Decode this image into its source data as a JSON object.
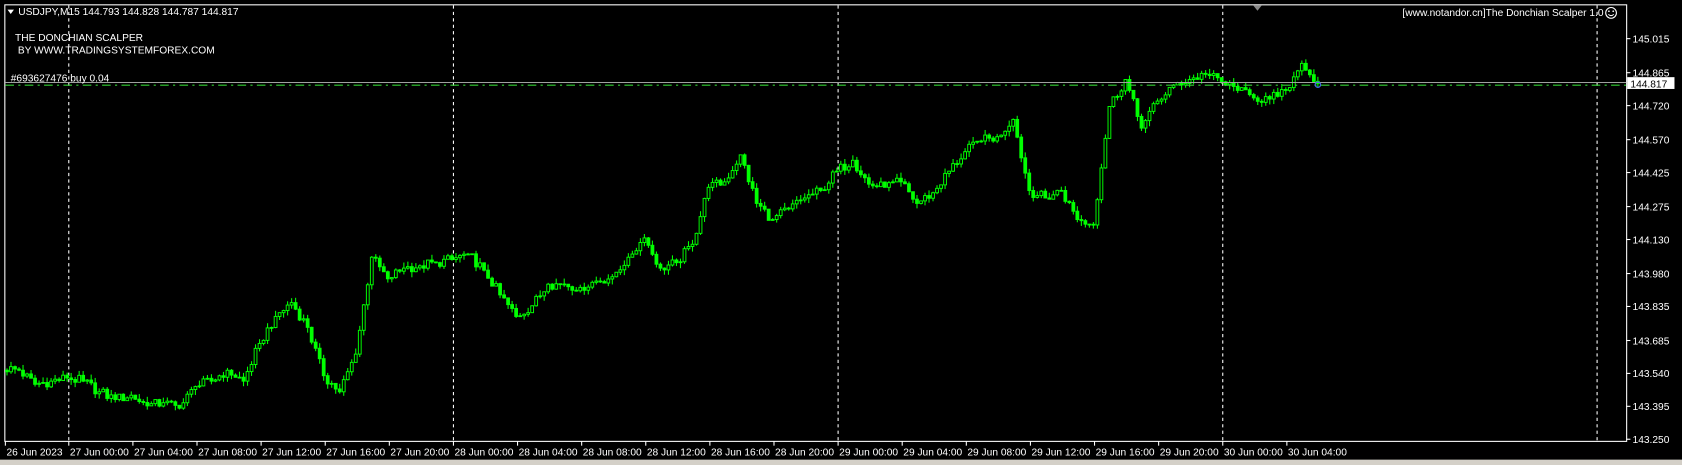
{
  "header": {
    "symbol_line": "USDJPY,M15  144.793 144.828 144.787 144.817",
    "indicator_title_1": "THE DONCHIAN SCALPER",
    "indicator_title_2": " BY WWW.TRADINGSYSTEMFOREX.COM",
    "order_label": "#693627476 buy 0.04",
    "expert_label": "[www.notandor.cn]The Donchian Scalper 1.0",
    "expert_icon": "smiley-icon"
  },
  "colors": {
    "bull": "#00ff00",
    "bear": "#00ff00",
    "background": "#000000",
    "grid": "#ffffff",
    "order_line": "#32cd32",
    "bid_line": "#a0a0a0"
  },
  "chart_data": {
    "type": "candlestick",
    "symbol": "USDJPY",
    "timeframe": "M15",
    "current_price": "144.817",
    "price_ticks": [
      "145.015",
      "144.865",
      "144.720",
      "144.570",
      "144.425",
      "144.275",
      "144.130",
      "143.980",
      "143.835",
      "143.685",
      "143.540",
      "143.395",
      "143.250"
    ],
    "time_labels": [
      "26 Jun 2023",
      "27 Jun 00:00",
      "27 Jun 04:00",
      "27 Jun 08:00",
      "27 Jun 12:00",
      "27 Jun 16:00",
      "27 Jun 20:00",
      "28 Jun 00:00",
      "28 Jun 04:00",
      "28 Jun 08:00",
      "28 Jun 12:00",
      "28 Jun 16:00",
      "28 Jun 20:00",
      "29 Jun 00:00",
      "29 Jun 04:00",
      "29 Jun 08:00",
      "29 Jun 12:00",
      "29 Jun 16:00",
      "29 Jun 20:00",
      "30 Jun 00:00",
      "30 Jun 04:00"
    ],
    "hourly_closes": [
      143.554,
      143.492,
      143.506,
      143.52,
      143.506,
      143.459,
      143.425,
      143.444,
      143.397,
      143.411,
      143.387,
      143.482,
      143.506,
      143.554,
      143.506,
      143.672,
      143.791,
      143.852,
      143.743,
      143.53,
      143.459,
      143.625,
      144.052,
      143.957,
      144.004,
      144.014,
      144.028,
      144.042,
      144.066,
      143.995,
      143.886,
      143.791,
      143.838,
      143.933,
      143.933,
      143.919,
      143.947,
      143.966,
      144.052,
      144.137,
      144.004,
      144.028,
      144.109,
      144.36,
      144.384,
      144.503,
      144.289,
      144.218,
      144.265,
      144.313,
      144.346,
      144.431,
      144.479,
      144.374,
      144.36,
      144.384,
      144.289,
      144.336,
      144.431,
      144.517,
      144.564,
      144.583,
      144.659,
      144.346,
      144.313,
      144.346,
      144.218,
      144.194,
      144.716,
      144.835,
      144.621,
      144.74,
      144.811,
      144.835,
      144.858,
      144.825,
      144.787,
      144.754,
      144.749,
      144.787,
      144.906,
      144.817
    ]
  }
}
